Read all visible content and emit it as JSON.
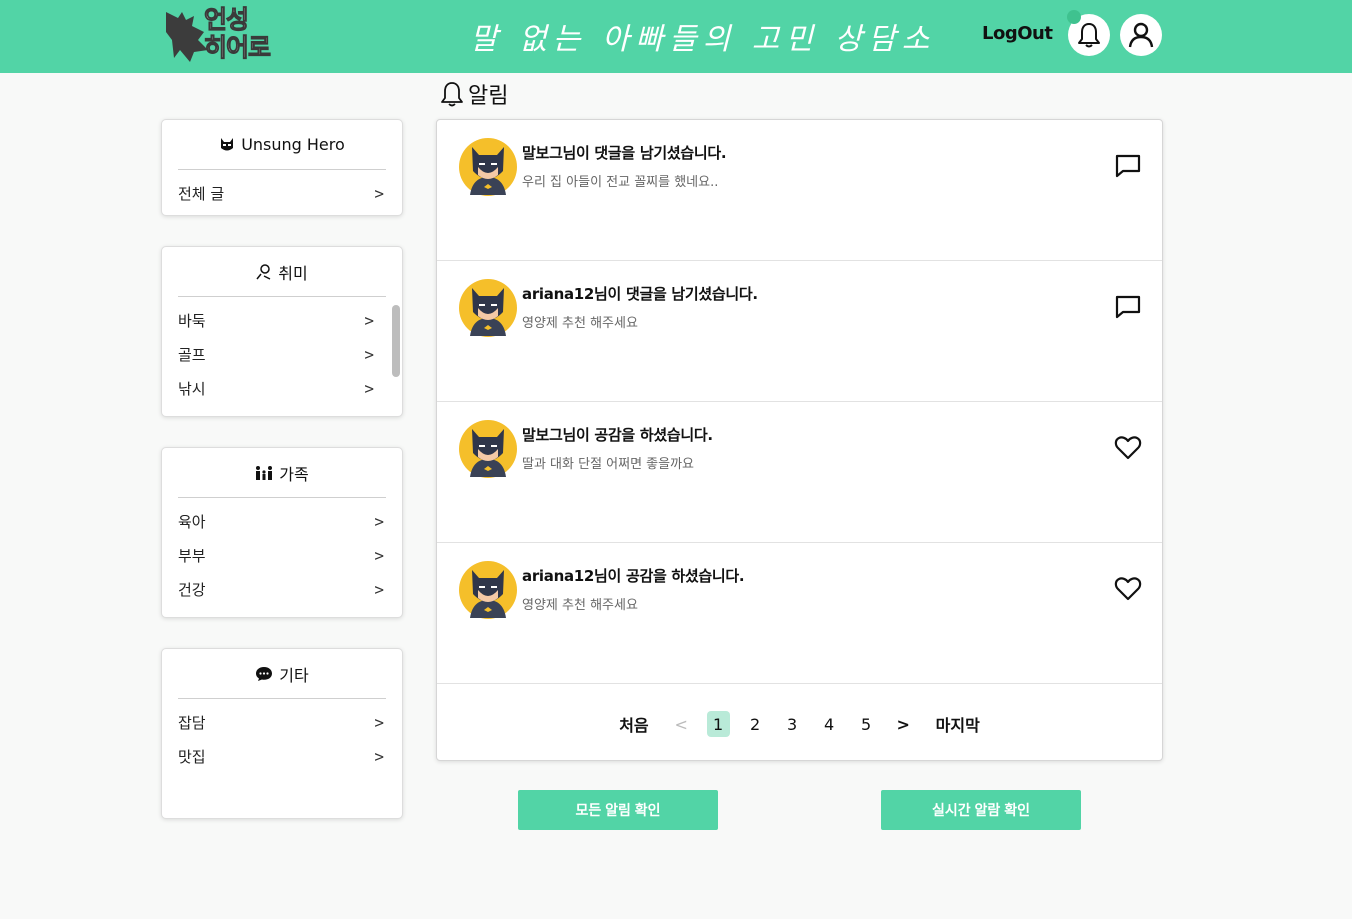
{
  "header": {
    "logo_line1": "언성",
    "logo_line2": "히어로",
    "site_title": "말 없는 아빠들의 고민 상담소",
    "logout_label": "LogOut",
    "bell_icon": "bell-icon",
    "user_icon": "user-icon",
    "accent_color": "#52d4a6"
  },
  "sidebar": {
    "main": {
      "title": "Unsung Hero",
      "icon": "mask-icon",
      "items": [
        {
          "label": "전체 글"
        }
      ]
    },
    "hobby": {
      "title": "취미",
      "icon": "person-icon",
      "items": [
        {
          "label": "바둑"
        },
        {
          "label": "골프"
        },
        {
          "label": "낚시"
        }
      ]
    },
    "family": {
      "title": "가족",
      "icon": "family-icon",
      "items": [
        {
          "label": "육아"
        },
        {
          "label": "부부"
        },
        {
          "label": "건강"
        }
      ]
    },
    "etc": {
      "title": "기타",
      "icon": "chat-bubble-icon",
      "items": [
        {
          "label": "잡담"
        },
        {
          "label": "맛집"
        }
      ]
    }
  },
  "page": {
    "heading": "알림"
  },
  "notifications": [
    {
      "title": "말보그님이 댓글을 남기셨습니다.",
      "preview": "우리 집 아들이 전교 꼴찌를 했네요..",
      "type": "comment"
    },
    {
      "title": "ariana12님이 댓글을 남기셨습니다.",
      "preview": "영양제 추천 해주세요",
      "type": "comment"
    },
    {
      "title": "말보그님이 공감을 하셨습니다.",
      "preview": "딸과 대화 단절 어쩌면 좋을까요",
      "type": "like"
    },
    {
      "title": "ariana12님이 공감을 하셨습니다.",
      "preview": "영양제 추천 해주세요",
      "type": "like"
    }
  ],
  "pagination": {
    "first": "처음",
    "prev": "<",
    "pages": [
      "1",
      "2",
      "3",
      "4",
      "5"
    ],
    "current": "1",
    "next": ">",
    "last": "마지막"
  },
  "actions": {
    "check_all": "모든 알림 확인",
    "check_live": "실시간 알람 확인"
  }
}
